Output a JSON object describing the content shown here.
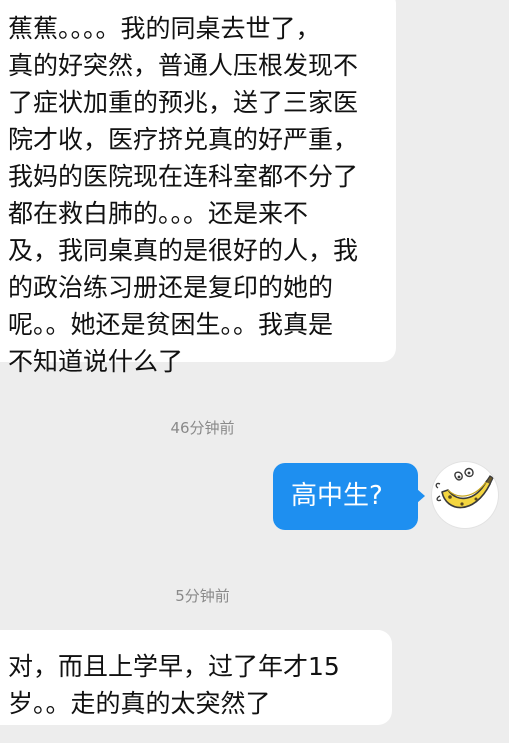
{
  "conversation": {
    "messages": [
      {
        "sender": "other",
        "lines": [
          "蕉蕉。。。。我的同桌去世了，",
          "真的好突然，普通人压根发现不",
          "了症状加重的预兆，送了三家医",
          "院才收，医疗挤兑真的好严重，",
          "我妈的医院现在连科室都不分了",
          "都在救白肺的。。。还是来不",
          "及，我同桌真的是很好的人，我",
          "的政治练习册还是复印的她的",
          "呢。。她还是贫困生。。我真是",
          "不知道说什么了"
        ]
      },
      {
        "sender": "timestamp",
        "text": "46分钟前"
      },
      {
        "sender": "me",
        "text": "高中生?"
      },
      {
        "sender": "timestamp",
        "text": "5分钟前"
      },
      {
        "sender": "other",
        "lines": [
          "对，而且上学早，过了年才15",
          "岁。。走的真的太突然了"
        ]
      }
    ],
    "my_avatar_icon": "banana-avatar-icon"
  },
  "colors": {
    "background": "#ededed",
    "incoming_bubble": "#ffffff",
    "outgoing_bubble": "#1e8ff0",
    "timestamp_text": "#8a8a8a"
  }
}
